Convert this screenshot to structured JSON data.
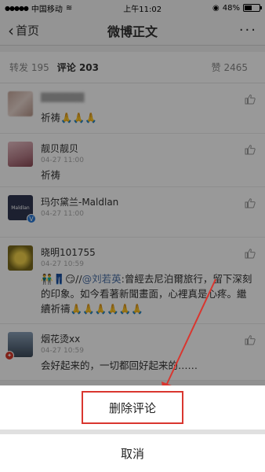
{
  "status_bar": {
    "carrier": "中国移动",
    "time": "上午11:02",
    "battery": "48%",
    "battery_level": 0.48
  },
  "nav": {
    "back_label": "首页",
    "title": "微博正文",
    "more": "···"
  },
  "tabs": {
    "repost_label": "转发",
    "repost_count": "195",
    "comment_label": "评论",
    "comment_count": "203",
    "like_label": "赞",
    "like_count": "2465"
  },
  "comments": [
    {
      "name": "",
      "time": "",
      "text": "祈祷🙏🙏🙏"
    },
    {
      "name": "靓贝靓贝",
      "time": "04-27 11:00",
      "text": "祈祷"
    },
    {
      "name": "玛尔黛兰-Maldlan",
      "time": "04-27 11:00",
      "text": "",
      "avatar_text": "Maldlan"
    },
    {
      "name": "晓明101755",
      "time": "04-27 10:59",
      "text_prefix": "👬👖😏//",
      "mention": "@刘若英",
      "text": ":曾經去尼泊爾旅行，留下深刻的印象。如今看著新聞畫面，心裡真是心疼。繼續祈禱🙏🙏🙏🙏🙏🙏"
    },
    {
      "name": "烟花烫xx",
      "time": "04-27 10:59",
      "text": "会好起来的，一切都回好起来的……"
    }
  ],
  "sheet": {
    "delete_label": "删除评论",
    "cancel_label": "取消"
  },
  "colors": {
    "accent_red": "#d9362f",
    "mention_blue": "#4a6fa5"
  }
}
